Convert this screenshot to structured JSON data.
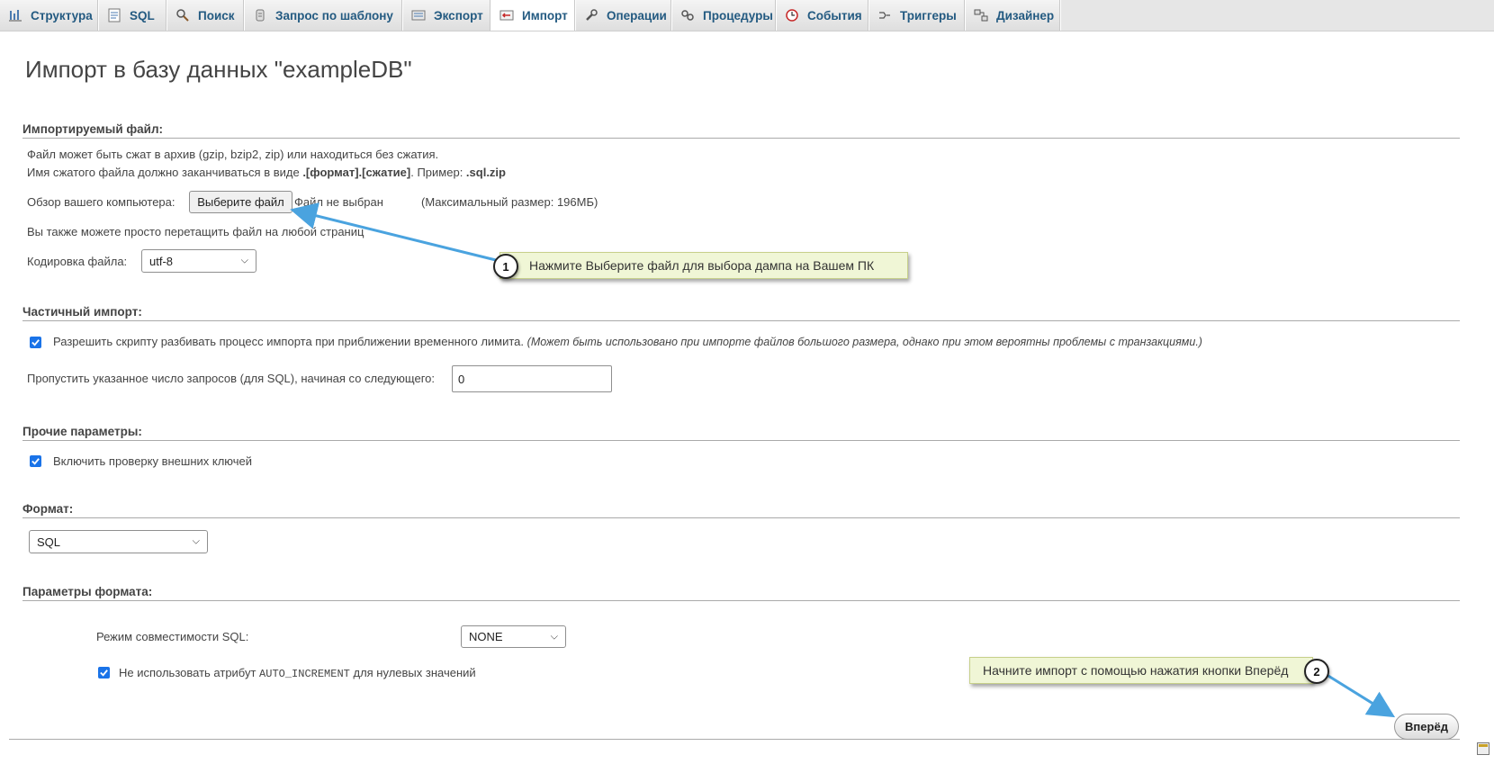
{
  "tabs": [
    {
      "label": "Структура",
      "icon": "structure-icon",
      "active": false
    },
    {
      "label": "SQL",
      "icon": "sql-icon",
      "active": false
    },
    {
      "label": "Поиск",
      "icon": "search-icon",
      "active": false
    },
    {
      "label": "Запрос по шаблону",
      "icon": "query-icon",
      "active": false
    },
    {
      "label": "Экспорт",
      "icon": "export-icon",
      "active": false
    },
    {
      "label": "Импорт",
      "icon": "import-icon",
      "active": true
    },
    {
      "label": "Операции",
      "icon": "wrench-icon",
      "active": false
    },
    {
      "label": "Процедуры",
      "icon": "routines-icon",
      "active": false
    },
    {
      "label": "События",
      "icon": "clock-icon",
      "active": false
    },
    {
      "label": "Триггеры",
      "icon": "triggers-icon",
      "active": false
    },
    {
      "label": "Дизайнер",
      "icon": "designer-icon",
      "active": false
    }
  ],
  "page_title": "Импорт в базу данных \"exampleDB\"",
  "file_section": {
    "heading": "Импортируемый файл:",
    "note1": "Файл может быть сжат в архив (gzip, bzip2, zip) или находиться без сжатия.",
    "note2_prefix": "Имя сжатого файла должно заканчиваться в виде ",
    "note2_format": ".[формат].[сжатие]",
    "note2_middle": ". Пример: ",
    "note2_example": ".sql.zip",
    "browse_label": "Обзор вашего компьютера:",
    "choose_button": "Выберите файл",
    "no_file": "Файл не выбран",
    "max_size": "(Максимальный размер: 196МБ)",
    "drag_note": "Вы также можете просто перетащить файл на любой страниц",
    "charset_label": "Кодировка файла:",
    "charset_value": "utf-8"
  },
  "partial_section": {
    "heading": "Частичный импорт:",
    "allow_interrupt_label": "Разрешить скрипту разбивать процесс импорта при приближении временного лимита.",
    "allow_interrupt_note": "(Может быть использовано при импорте файлов большого размера, однако при этом вероятны проблемы с транзакциями.)",
    "allow_interrupt_checked": true,
    "skip_label": "Пропустить указанное число запросов (для SQL), начиная со следующего:",
    "skip_value": "0"
  },
  "other_section": {
    "heading": "Прочие параметры:",
    "fk_label": "Включить проверку внешних ключей",
    "fk_checked": true
  },
  "format_section": {
    "heading": "Формат:",
    "format_value": "SQL"
  },
  "format_options_section": {
    "heading": "Параметры формата:",
    "compat_label": "Режим совместимости SQL:",
    "compat_value": "NONE",
    "autoinc_prefix": "Не использовать атрибут ",
    "autoinc_code": "AUTO_INCREMENT",
    "autoinc_suffix": " для нулевых значений",
    "autoinc_checked": true
  },
  "callouts": [
    {
      "number": "1",
      "text": "Нажмите Выберите файл для выбора дампа на Вашем ПК"
    },
    {
      "number": "2",
      "text": "Начните импорт с помощью нажатия кнопки Вперёд"
    }
  ],
  "go_button": "Вперёд",
  "colors": {
    "tab_text": "#235a81",
    "callout_bg": "#f0f6d6",
    "arrow": "#4aa3df",
    "checkbox": "#1a73e8"
  }
}
